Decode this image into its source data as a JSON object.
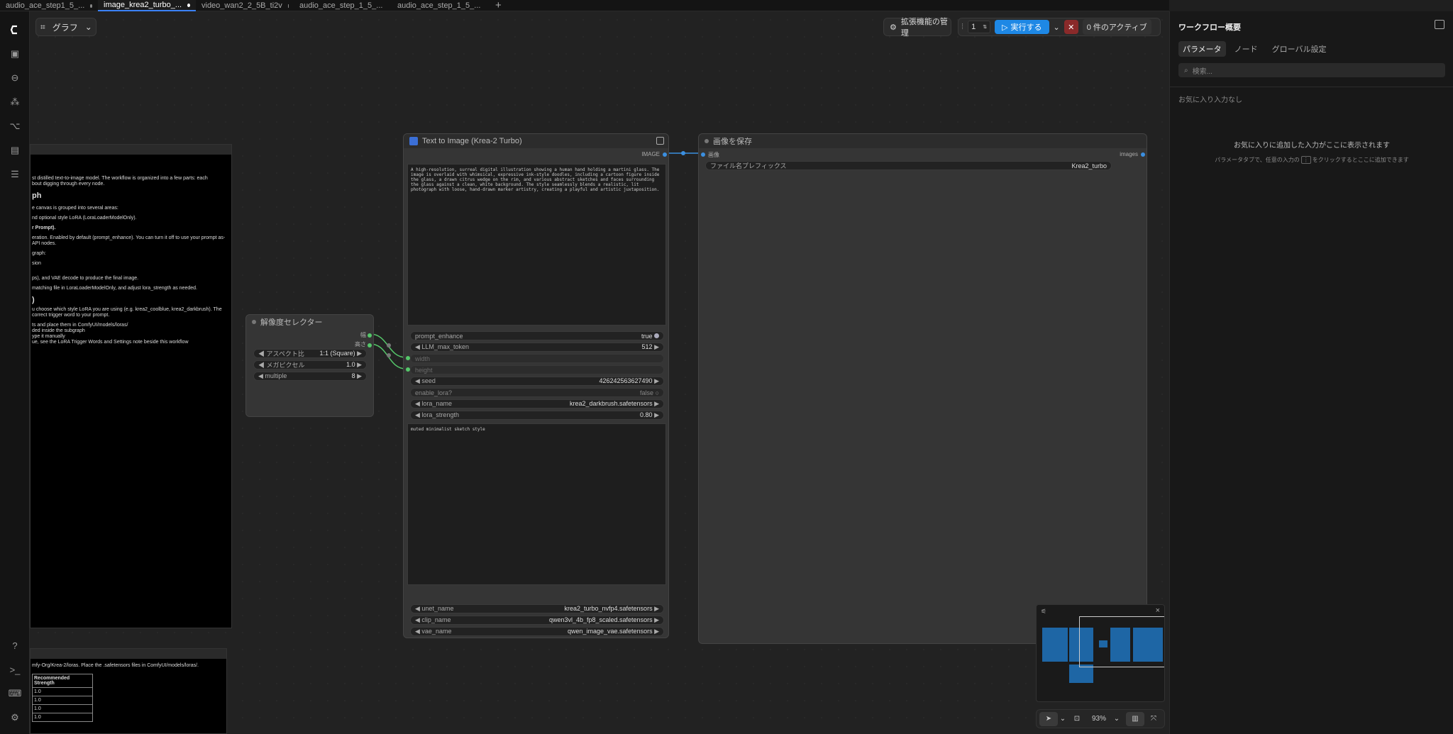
{
  "tabs": [
    "audio_ace_step1_5_...",
    "image_krea2_turbo_...",
    "video_wan2_2_5B_ti2v",
    "audio_ace_step_1_5_...",
    "audio_ace_step_1_5_..."
  ],
  "canvas_toolbar": {
    "graph_label": "グラフ",
    "extensions_label": "拡張機能の管理",
    "queue_count": "1",
    "run_label": "実行する",
    "active_label": "0 件のアクティブ"
  },
  "right_panel": {
    "title": "ワークフロー概要",
    "tabs": [
      "パラメータ",
      "ノード",
      "グローバル設定"
    ],
    "search_placeholder": "検索...",
    "favorites_heading": "お気に入り入力なし",
    "empty_title": "お気に入りに追加した入力がここに表示されます",
    "empty_hint_pre": "パラメータタブで、任意の入力の",
    "empty_hint_post": "をクリックするとここに追加できます"
  },
  "note_top": {
    "lines": [
      "st distilled text-to-image model. The workflow is organized into a few parts: each",
      "bout digging through every node."
    ],
    "heading1": "ph",
    "lines2": [
      "e canvas is grouped into several areas:",
      "nd optional style LoRA (LoraLoaderModelOnly).",
      "r Prompt).",
      "eration. Enabled by default (prompt_enhance). You can turn it off to use your prompt as-",
      "API nodes.",
      "graph:",
      "sion",
      "ps), and VAE decode to produce the final image.",
      "matching file in LoraLoaderModelOnly, and adjust lora_strength as needed."
    ],
    "heading2": ")",
    "lines3": [
      "u choose which style LoRA you are using (e.g. krea2_coolblue, krea2_darkbrush). The",
      "correct trigger word to your prompt.",
      "ts and place them in ComfyUI/models/loras/",
      "ded inside the subgraph",
      "ype it manually",
      "ue, see the LoRA Trigger Words and Settings note beside this workflow"
    ]
  },
  "note_bottom": {
    "line": "mfy-Org/Krea-2/loras. Place the .safetensors files in ComfyUI/models/loras/.",
    "table_header": "Recommended Strength",
    "table_rows": [
      "1.0",
      "1.0",
      "1.0",
      "1.0"
    ]
  },
  "resolution_node": {
    "title": "解像度セレクター",
    "out1": "幅",
    "out2": "高さ",
    "widgets": [
      {
        "label": "アスペクト比",
        "value": "1:1 (Square)"
      },
      {
        "label": "メガピクセル",
        "value": "1.0"
      },
      {
        "label": "multiple",
        "value": "8"
      }
    ]
  },
  "t2i_node": {
    "title": "Text to Image (Krea-2 Turbo)",
    "out": "IMAGE",
    "prompt": "A high-resolution, surreal digital illustration showing a human hand holding a martini glass. The image is overlaid with whimsical, expressive ink-style doodles, including a cartoon figure inside the glass, a drawn citrus wedge on the rim, and various abstract sketches and faces surrounding the glass against a clean, white background. The style seamlessly blends a realistic, lit photograph with loose, hand-drawn marker artistry, creating a playful and artistic juxtaposition.",
    "widgets": [
      {
        "label": "prompt_enhance",
        "value": "true"
      },
      {
        "label": "LLM_max_token",
        "value": "512"
      },
      {
        "label": "width",
        "value": ""
      },
      {
        "label": "height",
        "value": ""
      },
      {
        "label": "seed",
        "value": "426242563627490"
      },
      {
        "label": "enable_lora?",
        "value": "false"
      },
      {
        "label": "lora_name",
        "value": "krea2_darkbrush.safetensors"
      },
      {
        "label": "lora_strength",
        "value": "0.80"
      }
    ],
    "style_text": "muted minimalist sketch style",
    "models": [
      {
        "label": "unet_name",
        "value": "krea2_turbo_nvfp4.safetensors"
      },
      {
        "label": "clip_name",
        "value": "qwen3vl_4b_fp8_scaled.safetensors"
      },
      {
        "label": "vae_name",
        "value": "qwen_image_vae.safetensors"
      }
    ]
  },
  "save_node": {
    "title": "画像を保存",
    "in": "画像",
    "out": "images",
    "widget_label": "ファイル名プレフィックス",
    "widget_value": "Krea2_turbo"
  },
  "zoom": {
    "value": "93%"
  }
}
